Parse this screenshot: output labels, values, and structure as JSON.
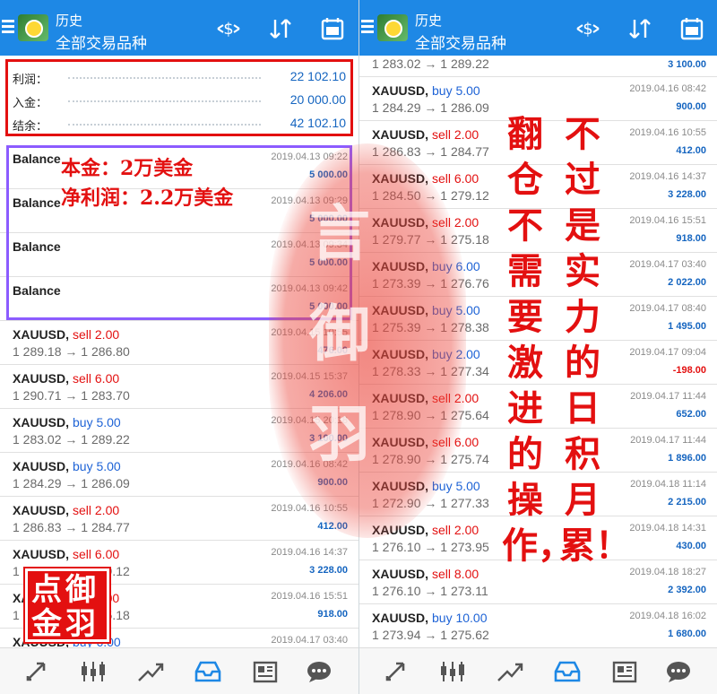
{
  "appbar": {
    "title": "历史",
    "subtitle": "全部交易品种"
  },
  "icons": {
    "menu": "menu-icon",
    "app_logo": "metatrader-logo",
    "sort_amount": "dollar-sort-icon",
    "sort": "sort-arrows-icon",
    "calendar": "calendar-icon"
  },
  "summary": [
    {
      "label": "利润：",
      "value": "22 102.10"
    },
    {
      "label": "入金：",
      "value": "20 000.00"
    },
    {
      "label": "结余：",
      "value": "42 102.10"
    }
  ],
  "left_rows": [
    {
      "symbol": "Balance",
      "side": "",
      "type": "",
      "prices": "",
      "time": "2019.04.13 09:22",
      "profit": "5 000.00"
    },
    {
      "symbol": "Balance",
      "side": "",
      "type": "",
      "prices": "",
      "time": "2019.04.13 09:29",
      "profit": "5 000.00"
    },
    {
      "symbol": "Balance",
      "side": "",
      "type": "",
      "prices": "",
      "time": "2019.04.13 09:34",
      "profit": "5 000.00"
    },
    {
      "symbol": "Balance",
      "side": "",
      "type": "",
      "prices": "",
      "time": "2019.04.13 09:42",
      "profit": "5 000.00"
    },
    {
      "symbol": "XAUUSD,",
      "side": "sell 2.00",
      "type": "sell",
      "prices": "1 289.18 → 1 286.80",
      "time": "2019.04.15 10:55",
      "profit": "476.00"
    },
    {
      "symbol": "XAUUSD,",
      "side": "sell 6.00",
      "type": "sell",
      "prices": "1 290.71 → 1 283.70",
      "time": "2019.04.15 15:37",
      "profit": "4 206.00"
    },
    {
      "symbol": "XAUUSD,",
      "side": "buy 5.00",
      "type": "buy",
      "prices": "1 283.02 → 1 289.22",
      "time": "2019.04.15 20:18",
      "profit": "3 100.00"
    },
    {
      "symbol": "XAUUSD,",
      "side": "buy 5.00",
      "type": "buy",
      "prices": "1 284.29 → 1 286.09",
      "time": "2019.04.16 08:42",
      "profit": "900.00"
    },
    {
      "symbol": "XAUUSD,",
      "side": "sell 2.00",
      "type": "sell",
      "prices": "1 286.83 → 1 284.77",
      "time": "2019.04.16 10:55",
      "profit": "412.00"
    },
    {
      "symbol": "XAUUSD,",
      "side": "sell 6.00",
      "type": "sell",
      "prices": "1 284.50 → 1 279.12",
      "time": "2019.04.16 14:37",
      "profit": "3 228.00"
    },
    {
      "symbol": "XAUUSD,",
      "side": "sell 2.00",
      "type": "sell",
      "prices": "1 279.77 → 1 275.18",
      "time": "2019.04.16 15:51",
      "profit": "918.00"
    },
    {
      "symbol": "XAUUSD,",
      "side": "buy 6.00",
      "type": "buy",
      "prices": "",
      "time": "2019.04.17 03:40",
      "profit": ""
    }
  ],
  "right_top": {
    "prices": "1 283.02 → 1 289.22",
    "profit": "3 100.00"
  },
  "right_rows": [
    {
      "symbol": "XAUUSD,",
      "side": "buy 5.00",
      "type": "buy",
      "prices": "1 284.29 → 1 286.09",
      "time": "2019.04.16 08:42",
      "profit": "900.00"
    },
    {
      "symbol": "XAUUSD,",
      "side": "sell 2.00",
      "type": "sell",
      "prices": "1 286.83 → 1 284.77",
      "time": "2019.04.16 10:55",
      "profit": "412.00"
    },
    {
      "symbol": "XAUUSD,",
      "side": "sell 6.00",
      "type": "sell",
      "prices": "1 284.50 → 1 279.12",
      "time": "2019.04.16 14:37",
      "profit": "3 228.00"
    },
    {
      "symbol": "XAUUSD,",
      "side": "sell 2.00",
      "type": "sell",
      "prices": "1 279.77 → 1 275.18",
      "time": "2019.04.16 15:51",
      "profit": "918.00"
    },
    {
      "symbol": "XAUUSD,",
      "side": "buy 6.00",
      "type": "buy",
      "prices": "1 273.39 → 1 276.76",
      "time": "2019.04.17 03:40",
      "profit": "2 022.00"
    },
    {
      "symbol": "XAUUSD,",
      "side": "buy 5.00",
      "type": "buy",
      "prices": "1 275.39 → 1 278.38",
      "time": "2019.04.17 08:40",
      "profit": "1 495.00"
    },
    {
      "symbol": "XAUUSD,",
      "side": "buy 2.00",
      "type": "buy",
      "prices": "1 278.33 → 1 277.34",
      "time": "2019.04.17 09:04",
      "profit": "-198.00"
    },
    {
      "symbol": "XAUUSD,",
      "side": "sell 2.00",
      "type": "sell",
      "prices": "1 278.90 → 1 275.64",
      "time": "2019.04.17 11:44",
      "profit": "652.00"
    },
    {
      "symbol": "XAUUSD,",
      "side": "sell 6.00",
      "type": "sell",
      "prices": "1 278.90 → 1 275.74",
      "time": "2019.04.17 11:44",
      "profit": "1 896.00"
    },
    {
      "symbol": "XAUUSD,",
      "side": "buy 5.00",
      "type": "buy",
      "prices": "1 272.90 → 1 277.33",
      "time": "2019.04.18 11:14",
      "profit": "2 215.00"
    },
    {
      "symbol": "XAUUSD,",
      "side": "sell 2.00",
      "type": "sell",
      "prices": "1 276.10 → 1 273.95",
      "time": "2019.04.18 14:31",
      "profit": "430.00"
    },
    {
      "symbol": "XAUUSD,",
      "side": "sell 8.00",
      "type": "sell",
      "prices": "1 276.10 → 1 273.11",
      "time": "2019.04.18 18:27",
      "profit": "2 392.00"
    },
    {
      "symbol": "XAUUSD,",
      "side": "buy 10.00",
      "type": "buy",
      "prices": "1 273.94 → 1 275.62",
      "time": "2019.04.18 16:02",
      "profit": "1 680.00"
    }
  ],
  "bottom_nav": [
    "quotes-icon",
    "chart-icon",
    "trade-icon",
    "history-icon",
    "news-icon",
    "chat-icon"
  ],
  "annotations": {
    "capital": "本金：2万美金",
    "net_profit": "净利润：2.2万美金",
    "vertical_left": "翻仓不需要激进的操作，",
    "vertical_right": "不过是实力的日积月累！"
  },
  "watermark": {
    "seal_text": "言御羽",
    "stamp_text": "点御金羽"
  },
  "colors": {
    "appbar": "#1e88e5",
    "buy": "#1e63d6",
    "sell": "#e31010",
    "profit": "#1565c0",
    "highlight_red": "#e31010",
    "highlight_purple": "#8c5cff"
  }
}
